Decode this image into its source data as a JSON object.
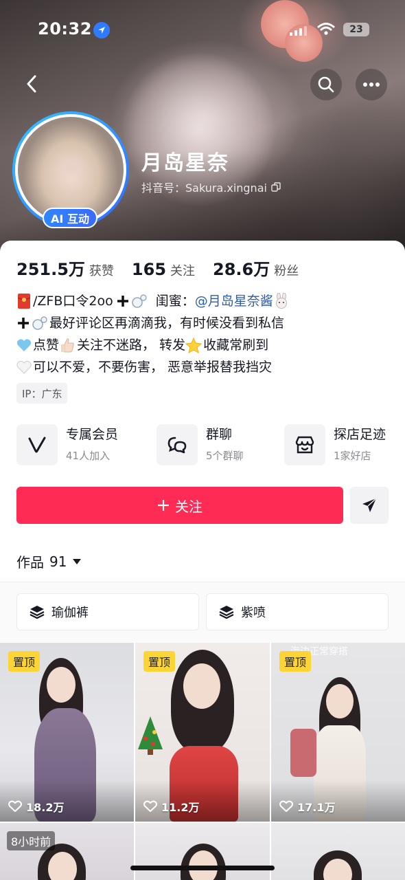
{
  "status_bar": {
    "time": "20:32",
    "battery": "23"
  },
  "profile": {
    "name": "月岛星奈",
    "douyin_id_label": "抖音号：Sakura.xingnai",
    "ai_badge": "AI 互动"
  },
  "stats": [
    {
      "value": "251.5万",
      "label": "获赞"
    },
    {
      "value": "165",
      "label": "关注"
    },
    {
      "value": "28.6万",
      "label": "粉丝"
    }
  ],
  "bio": {
    "line1_text": "/ZFB口令2oo",
    "line1_friend_label": "闺蜜：",
    "line1_mention": "@月岛星奈酱",
    "line2": "最好评论区再滴滴我，有时候没看到私信",
    "line3a": "点赞",
    "line3b": "关注不迷路， 转发",
    "line3c": "收藏常刷到",
    "line4": "可以不爱，不要伤害， 恶意举报替我挡灾"
  },
  "ip_label": "IP：广东",
  "features": [
    {
      "title": "专属会员",
      "sub": "41人加入",
      "icon": "v-icon"
    },
    {
      "title": "群聊",
      "sub": "5个群聊",
      "icon": "chat-bubbles-icon"
    },
    {
      "title": "探店足迹",
      "sub": "1家好店",
      "icon": "shop-icon"
    }
  ],
  "follow_button": "关注",
  "works_tab": {
    "label": "作品",
    "count": "91"
  },
  "collections": [
    {
      "label": "瑜伽裤",
      "icon": "stack-icon"
    },
    {
      "label": "紫喷",
      "icon": "stack-icon"
    }
  ],
  "videos": [
    {
      "pinned_label": "置顶",
      "likes": "18.2万"
    },
    {
      "pinned_label": "置顶",
      "likes": "11.2万"
    },
    {
      "pinned_label": "置顶",
      "likes": "17.1万",
      "caption": "海边正常穿搭"
    },
    {
      "time_ago": "8小时前"
    },
    {},
    {}
  ],
  "colors": {
    "follow": "#fe2c55",
    "mention": "#2f5ea8",
    "pin": "#fcd535",
    "ai_badge": "#2f86ff"
  }
}
